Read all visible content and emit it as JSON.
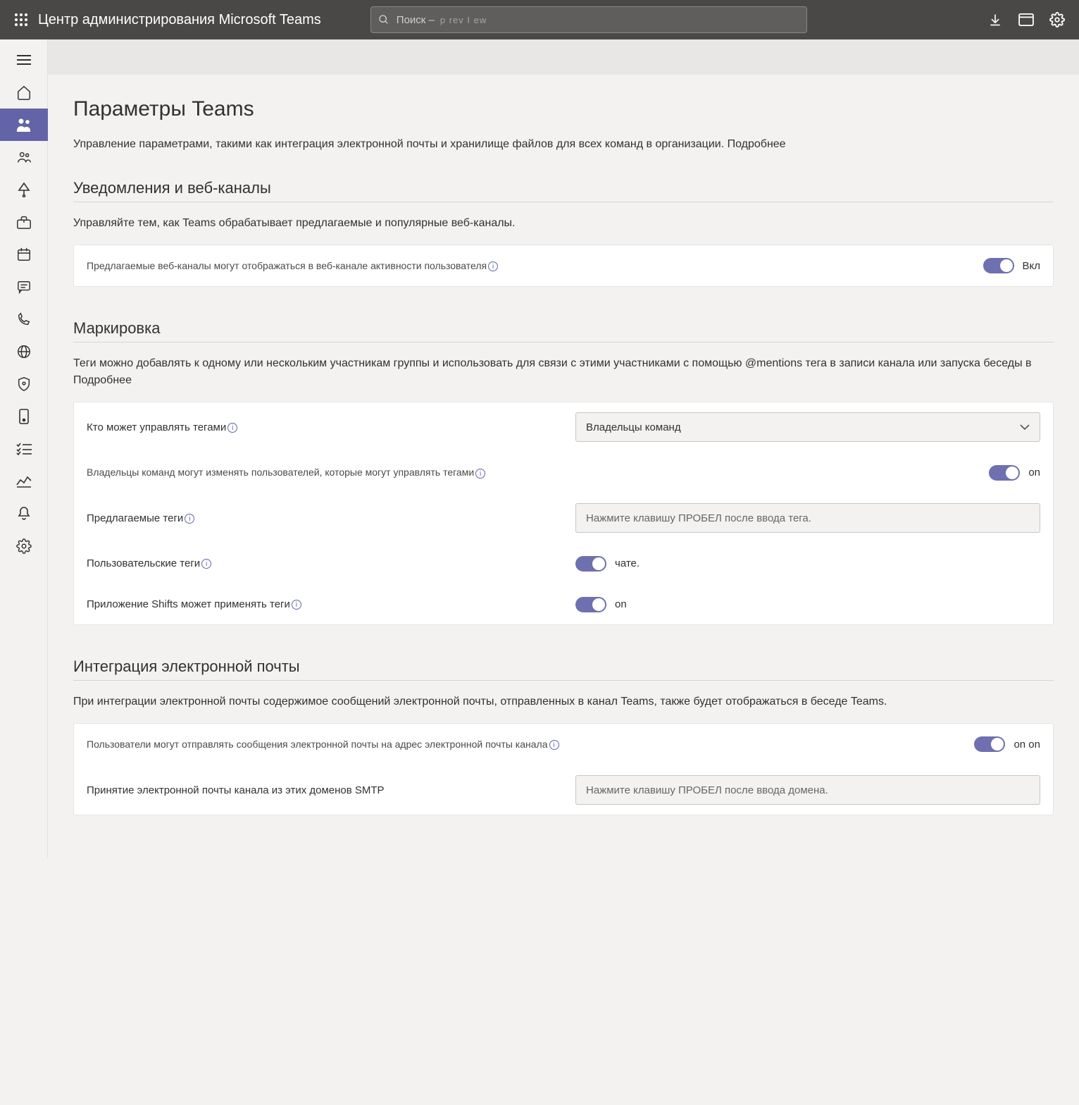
{
  "header": {
    "app_title": "Центр администрирования Microsoft Teams",
    "search_label": "Поиск –",
    "search_hint": "p rev I ew"
  },
  "page": {
    "title": "Параметры Teams",
    "description": "Управление параметрами, такими как интеграция электронной почты и хранилище файлов для всех команд в организации.",
    "learn_more": "Подробнее"
  },
  "notifications": {
    "title": "Уведомления и веб-каналы",
    "subtitle": "Управляйте тем, как Teams обрабатывает предлагаемые и популярные веб-каналы.",
    "suggested_feeds_label": "Предлагаемые веб-каналы могут отображаться в веб-канале активности пользователя",
    "suggested_feeds_state": "Вкл"
  },
  "tagging": {
    "title": "Маркировка",
    "subtitle": "Теги можно добавлять к одному или нескольким участникам группы и использовать для связи с этими участниками с помощью @mentions тега в записи канала или запуска беседы в",
    "learn_more": "Подробнее",
    "who_can_manage_label": "Кто может управлять тегами",
    "who_can_manage_value": "Владельцы команд",
    "owners_can_change_label": "Владельцы команд могут изменять пользователей, которые могут управлять тегами",
    "owners_can_change_state": "on",
    "suggested_tags_label": "Предлагаемые теги",
    "suggested_tags_placeholder": "Нажмите клавишу ПРОБЕЛ после ввода тега.",
    "custom_tags_label": "Пользовательские теги",
    "custom_tags_state": "чате.",
    "shifts_label": "Приложение Shifts может применять теги",
    "shifts_state": "on"
  },
  "email": {
    "title": "Интеграция электронной почты",
    "subtitle": "При интеграции электронной почты содержимое сообщений электронной почты, отправленных в канал Teams, также будет отображаться в беседе Teams.",
    "users_can_send_label": "Пользователи могут отправлять сообщения электронной почты на адрес электронной почты канала",
    "users_can_send_state": "on on",
    "smtp_domains_label": "Принятие электронной почты канала из этих доменов SMTP",
    "smtp_domains_placeholder": "Нажмите клавишу ПРОБЕЛ после ввода домена."
  }
}
